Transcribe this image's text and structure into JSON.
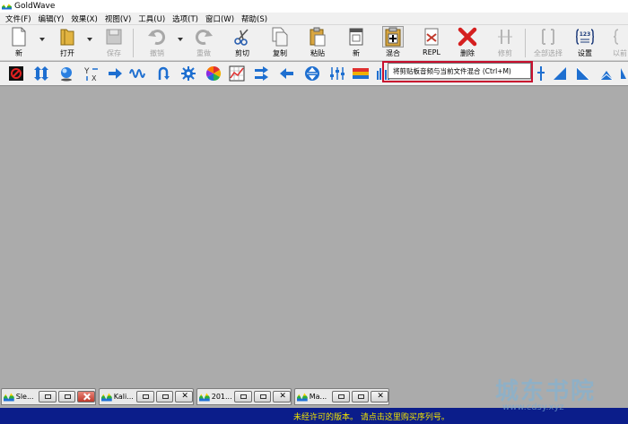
{
  "window": {
    "title": "GoldWave"
  },
  "menu": [
    {
      "id": "file",
      "label": "文件(F)"
    },
    {
      "id": "edit",
      "label": "编辑(Y)"
    },
    {
      "id": "effects",
      "label": "效果(X)"
    },
    {
      "id": "view",
      "label": "视图(V)"
    },
    {
      "id": "tools",
      "label": "工具(U)"
    },
    {
      "id": "options",
      "label": "选项(T)"
    },
    {
      "id": "window",
      "label": "窗口(W)"
    },
    {
      "id": "help",
      "label": "帮助(S)"
    }
  ],
  "toolbar": {
    "new": "新",
    "open": "打开",
    "save": "保存",
    "undo": "撤销",
    "redo": "重做",
    "cut": "剪切",
    "copy": "复制",
    "paste": "粘贴",
    "new2": "新",
    "mix": "混合",
    "repl": "REPL",
    "delete": "删除",
    "trim": "修剪",
    "selectall": "全部选择",
    "settings": "设置",
    "cue": "以前"
  },
  "effects_toolbar": [
    "stop-record-icon",
    "expand-icon",
    "globe-icon",
    "swap-xy-icon",
    "arrow-right-icon",
    "wave-icon",
    "loop-arrow-icon",
    "gear-icon",
    "color-wheel-icon",
    "equalizer-grid-icon",
    "double-arrow-icon",
    "arrow-left-icon",
    "compress-icon",
    "mixer-sliders-icon",
    "spectrum-icon"
  ],
  "tooltip": {
    "text": "将剪贴板音频与当前文件混合 (Ctrl+M)"
  },
  "sound_windows": [
    {
      "title": "Sle..."
    },
    {
      "title": "Kali..."
    },
    {
      "title": "201..."
    },
    {
      "title": "Ma..."
    }
  ],
  "status": {
    "message": "未经许可的版本。 请点击这里购买序列号。"
  },
  "watermark": {
    "text": "城东书院",
    "url": "www.cdsy.xyz"
  },
  "colors": {
    "status_bg": "#0b1d8a",
    "status_text": "#f2e400",
    "workspace": "#ababab"
  }
}
